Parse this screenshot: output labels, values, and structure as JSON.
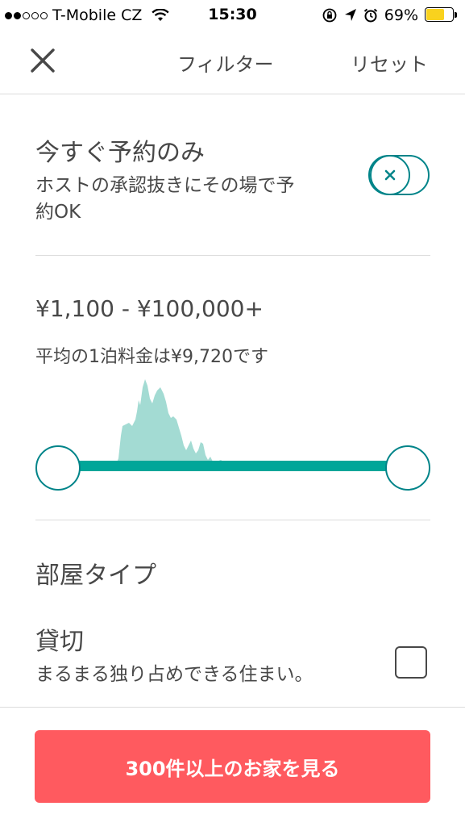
{
  "status_bar": {
    "carrier": "T-Mobile CZ",
    "time": "15:30",
    "battery": "69%",
    "battery_level": 0.69,
    "signal_bars_filled": 2,
    "signal_bars_total": 5,
    "icons": [
      "wifi-icon",
      "rotation-lock-icon",
      "location-arrow-icon",
      "alarm-icon",
      "battery-icon"
    ]
  },
  "nav": {
    "title": "フィルター",
    "reset_label": "リセット",
    "close_icon": "close-icon"
  },
  "instant_book": {
    "title": "今すぐ予約のみ",
    "description": "ホストの承認抜きにその場で予約OK",
    "toggle_state": "off",
    "toggle_color": "#008489"
  },
  "price": {
    "range": "¥1,100 - ¥100,000+",
    "average": "平均の1泊料金は¥9,720です",
    "slider_min": 0,
    "slider_max": 1,
    "histogram_color": "#a3dbd3",
    "track_color": "#00a699"
  },
  "room_type": {
    "title": "部屋タイプ",
    "options": [
      {
        "label": "貸切",
        "description": "まるまる独り占めできる住まい。",
        "checked": false
      }
    ]
  },
  "footer": {
    "cta_label": "300件以上のお家を見る",
    "cta_color": "#ff5a5f"
  }
}
